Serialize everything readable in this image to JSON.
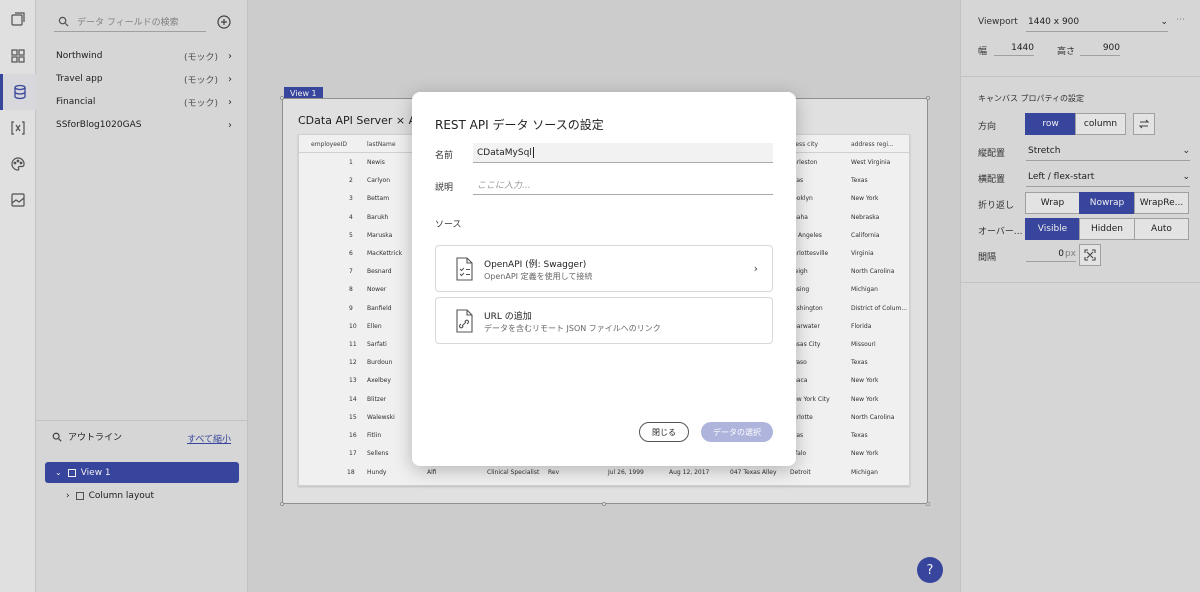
{
  "data_panel": {
    "search_placeholder": "データ フィールドの検索",
    "sources": [
      {
        "name": "Northwind",
        "mock": "(モック)"
      },
      {
        "name": "Travel app",
        "mock": "(モック)"
      },
      {
        "name": "Financial",
        "mock": "(モック)"
      },
      {
        "name": "SSforBlog1020GAS",
        "mock": ""
      }
    ]
  },
  "outline": {
    "title": "アウトライン",
    "collapse_all": "すべて縮小",
    "items": [
      {
        "label": "View 1"
      },
      {
        "label": "Column layout"
      }
    ]
  },
  "canvas": {
    "view_tag": "View 1",
    "app_title": "CData API Server × App B",
    "grid_headers": [
      "employeeID",
      "lastName",
      "",
      "",
      "",
      "",
      "",
      "ress city",
      "address regi..."
    ],
    "grid_rows": [
      {
        "id": "1",
        "last": "Newis",
        "city": "arleston",
        "region": "West Virginia"
      },
      {
        "id": "2",
        "last": "Carlyon",
        "city": "llas",
        "region": "Texas"
      },
      {
        "id": "3",
        "last": "Bettam",
        "city": "ooklyn",
        "region": "New York"
      },
      {
        "id": "4",
        "last": "Barukh",
        "city": "naha",
        "region": "Nebraska"
      },
      {
        "id": "5",
        "last": "Maruska",
        "city": "s Angeles",
        "region": "California"
      },
      {
        "id": "6",
        "last": "MacKettrick",
        "city": "arlottesville",
        "region": "Virginia"
      },
      {
        "id": "7",
        "last": "Besnard",
        "city": "leigh",
        "region": "North Carolina"
      },
      {
        "id": "8",
        "last": "Nower",
        "city": "nsing",
        "region": "Michigan"
      },
      {
        "id": "9",
        "last": "Banfield",
        "city": "ashington",
        "region": "District of Colum..."
      },
      {
        "id": "10",
        "last": "Ellen",
        "city": "earwater",
        "region": "Florida"
      },
      {
        "id": "11",
        "last": "Sarfati",
        "city": "nsas City",
        "region": "Missouri"
      },
      {
        "id": "12",
        "last": "Burdoun",
        "city": "Paso",
        "region": "Texas"
      },
      {
        "id": "13",
        "last": "Axelbey",
        "city": "haca",
        "region": "New York"
      },
      {
        "id": "14",
        "last": "Blitzer",
        "city": "ew York City",
        "region": "New York"
      },
      {
        "id": "15",
        "last": "Walewski",
        "city": "arlotte",
        "region": "North Carolina"
      },
      {
        "id": "16",
        "last": "Fitlin",
        "city": "llas",
        "region": "Texas"
      },
      {
        "id": "17",
        "last": "Sellens",
        "city": "ffalo",
        "region": "New York"
      }
    ],
    "last_row": [
      "18",
      "Hundy",
      "Alfi",
      "Clinical Specialist",
      "Rev",
      "Jul 26, 1999",
      "Aug 12, 2017",
      "047 Texas Alley",
      "Detroit",
      "Michigan"
    ]
  },
  "properties": {
    "viewport_label": "Viewport",
    "viewport_value": "1440 x 900",
    "width_label": "幅",
    "width_value": "1440",
    "height_label": "高さ",
    "height_value": "900",
    "canvas_settings": "キャンバス プロパティの設定",
    "direction_label": "方向",
    "direction_options": [
      "row",
      "column"
    ],
    "vertical_label": "縦配置",
    "vertical_value": "Stretch",
    "horizontal_label": "横配置",
    "horizontal_value": "Left / flex-start",
    "wrap_label": "折り返し",
    "wrap_options": [
      "Wrap",
      "Nowrap",
      "WrapRe..."
    ],
    "overflow_label": "オーバー...",
    "overflow_options": [
      "Visible",
      "Hidden",
      "Auto"
    ],
    "gap_label": "間隔",
    "gap_value": "0",
    "gap_unit": "px"
  },
  "help_label": "?",
  "modal": {
    "title": "REST API データ ソースの設定",
    "name_label": "名前",
    "name_value": "CDataMySql",
    "desc_label": "説明",
    "desc_placeholder": "ここに入力...",
    "source_label": "ソース",
    "openapi_title": "OpenAPI (例: Swagger)",
    "openapi_desc": "OpenAPI 定義を使用して接続",
    "url_title": "URL の追加",
    "url_desc": "データを含むリモート JSON ファイルへのリンク",
    "close_label": "閉じる",
    "select_label": "データの選択"
  },
  "colors": {
    "accent": "#3b4aa6",
    "accent_disabled": "#aeb4dc"
  }
}
